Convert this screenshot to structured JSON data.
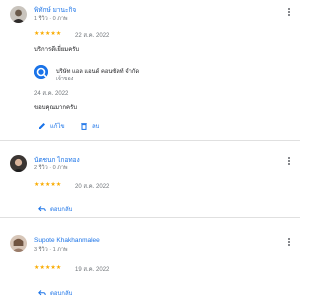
{
  "reviews": [
    {
      "name": "พิทักษ์ มานะกิจ",
      "meta": "1 รีวิว · 0 ภาพ",
      "stars": "★★★★★",
      "date": "22 ส.ค. 2022",
      "text": "บริการดีเยี่ยมครับ",
      "owner_reply": {
        "owner_name": "บริษัท แอล แอนด์ คอนซัลท์ จำกัด",
        "owner_role": "เจ้าของ",
        "date": "24 ส.ค. 2022",
        "text": "ขอบคุณมากครับ"
      },
      "actions": {
        "edit": "แก้ไข",
        "delete": "ลบ"
      }
    },
    {
      "name": "นัตชนก ไกอทอง",
      "meta": "2 รีวิว · 0 ภาพ",
      "stars": "★★★★★",
      "date": "20 ส.ค. 2022",
      "actions": {
        "reply": "ตอบกลับ"
      }
    },
    {
      "name": "Supote Khakhanmalee",
      "meta": "3 รีวิว · 1 ภาพ",
      "stars": "★★★★★",
      "date": "19 ส.ค. 2022",
      "actions": {
        "reply": "ตอบกลับ"
      }
    }
  ],
  "colors": {
    "accent": "#1a73e8",
    "star": "#f9ab00",
    "divider": "#e0e0e0"
  },
  "icons": [
    "avatar",
    "kebab-menu-icon",
    "pencil-icon",
    "trash-icon",
    "reply-arrow-icon",
    "owner-logo"
  ]
}
